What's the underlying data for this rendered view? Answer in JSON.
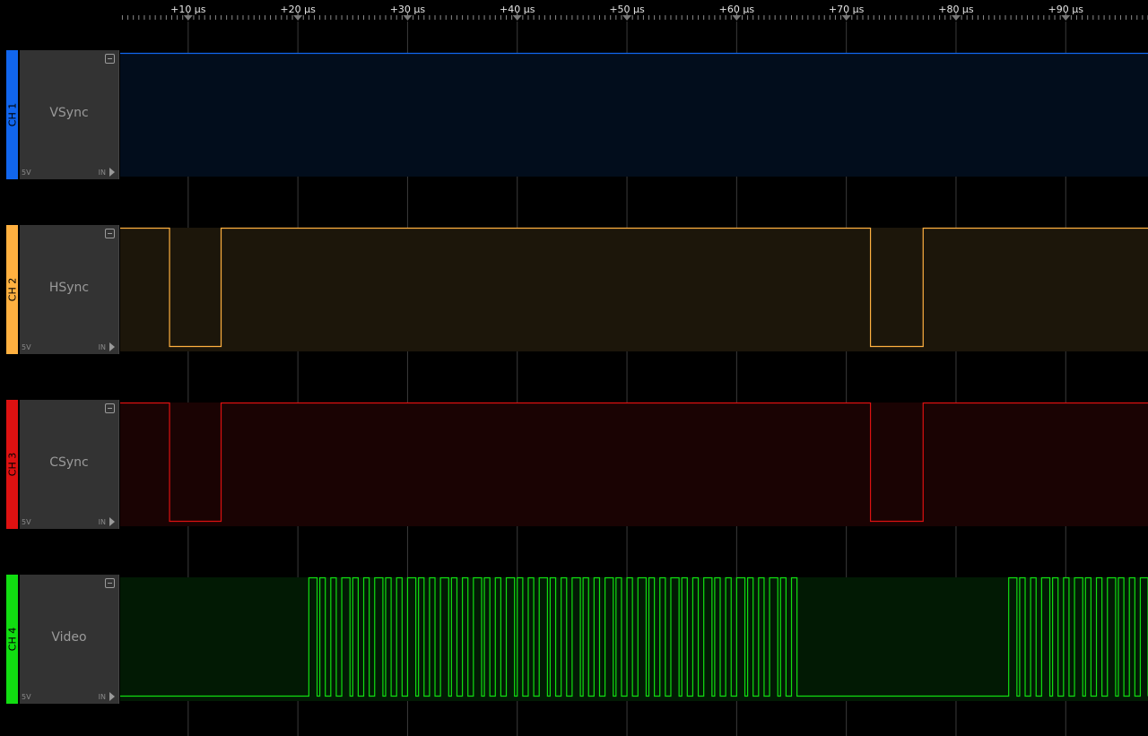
{
  "ruler": {
    "ticks": [
      {
        "label": "+10 µs",
        "t": 10
      },
      {
        "label": "+20 µs",
        "t": 20
      },
      {
        "label": "+30 µs",
        "t": 30
      },
      {
        "label": "+40 µs",
        "t": 40
      },
      {
        "label": "+50 µs",
        "t": 50
      },
      {
        "label": "+60 µs",
        "t": 60
      },
      {
        "label": "+70 µs",
        "t": 70
      },
      {
        "label": "+80 µs",
        "t": 80
      },
      {
        "label": "+90 µs",
        "t": 90
      }
    ],
    "view_start_us": 3.8,
    "view_end_us": 97.5
  },
  "channels": [
    {
      "id": "ch1",
      "tab_label": "CH 1",
      "name": "VSync",
      "voltage": "5V",
      "direction": "IN",
      "color": "#1166ee",
      "bg_color": "#020d1c",
      "wave": {
        "initial": 1,
        "edges_us": []
      }
    },
    {
      "id": "ch2",
      "tab_label": "CH 2",
      "name": "HSync",
      "voltage": "5V",
      "direction": "IN",
      "color": "#ffb040",
      "bg_color": "#1c160a",
      "wave": {
        "initial": 1,
        "edges_us": [
          8.3,
          13.0,
          72.2,
          77.0
        ]
      }
    },
    {
      "id": "ch3",
      "tab_label": "CH 3",
      "name": "CSync",
      "voltage": "5V",
      "direction": "IN",
      "color": "#dd1111",
      "bg_color": "#1a0303",
      "wave": {
        "initial": 1,
        "edges_us": [
          8.3,
          13.0,
          72.2,
          77.0
        ]
      }
    },
    {
      "id": "ch4",
      "tab_label": "CH 4",
      "name": "Video",
      "voltage": "5V",
      "direction": "IN",
      "color": "#11dd11",
      "bg_color": "#021a04",
      "wave": {
        "initial": 0,
        "burst1_start_us": 21.0,
        "burst1_end_us": 66.0,
        "burst2_start_us": 84.8,
        "burst2_end_us": 97.5,
        "pulse_period_us": 1.0
      }
    }
  ]
}
